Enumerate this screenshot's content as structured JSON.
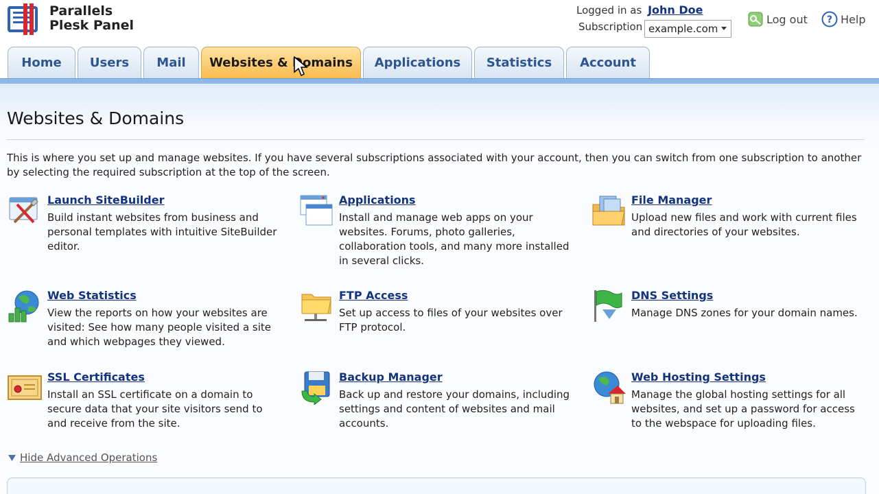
{
  "header": {
    "brand_line1": "Parallels",
    "brand_line2": "Plesk Panel",
    "logged_in_label": "Logged in as",
    "user_name": "John Doe",
    "subscription_label": "Subscription",
    "subscription_value": "example.com",
    "logout_label": "Log out",
    "help_label": "Help"
  },
  "tabs": [
    {
      "label": "Home"
    },
    {
      "label": "Users"
    },
    {
      "label": "Mail"
    },
    {
      "label": "Websites & Domains"
    },
    {
      "label": "Applications"
    },
    {
      "label": "Statistics"
    },
    {
      "label": "Account"
    }
  ],
  "page": {
    "title": "Websites & Domains",
    "intro": "This is where you set up and manage websites. If you have several subscriptions associated with your account, then you can switch from one subscription to another by selecting the required subscription at the top of the screen."
  },
  "items": [
    {
      "title": "Launch SiteBuilder",
      "desc": "Build instant websites from business and personal templates with intuitive SiteBuilder editor.",
      "icon": "sitebuilder-icon"
    },
    {
      "title": "Applications",
      "desc": "Install and manage web apps on your websites. Forums, photo galleries, collaboration tools, and many more installed in several clicks.",
      "icon": "applications-icon"
    },
    {
      "title": "File Manager",
      "desc": "Upload new files and work with current files and directories of your websites.",
      "icon": "file-manager-icon"
    },
    {
      "title": "Web Statistics",
      "desc": "View the reports on how your websites are visited: See how many people visited a site and which webpages they viewed.",
      "icon": "web-statistics-icon"
    },
    {
      "title": "FTP Access",
      "desc": "Set up access to files of your websites over FTP protocol.",
      "icon": "ftp-folder-icon"
    },
    {
      "title": "DNS Settings",
      "desc": "Manage DNS zones for your domain names.",
      "icon": "dns-flag-icon"
    },
    {
      "title": "SSL Certificates",
      "desc": "Install an SSL certificate on a domain to secure data that your site visitors send to and receive from the site.",
      "icon": "ssl-certificate-icon"
    },
    {
      "title": "Backup Manager",
      "desc": "Back up and restore your domains, including settings and content of websites and mail accounts.",
      "icon": "backup-floppy-icon"
    },
    {
      "title": "Web Hosting Settings",
      "desc": "Manage the global hosting settings for all websites, and set up a password for access to the webspace for uploading files.",
      "icon": "web-hosting-globe-house-icon"
    }
  ],
  "advanced": {
    "label": "Hide Advanced Operations"
  }
}
